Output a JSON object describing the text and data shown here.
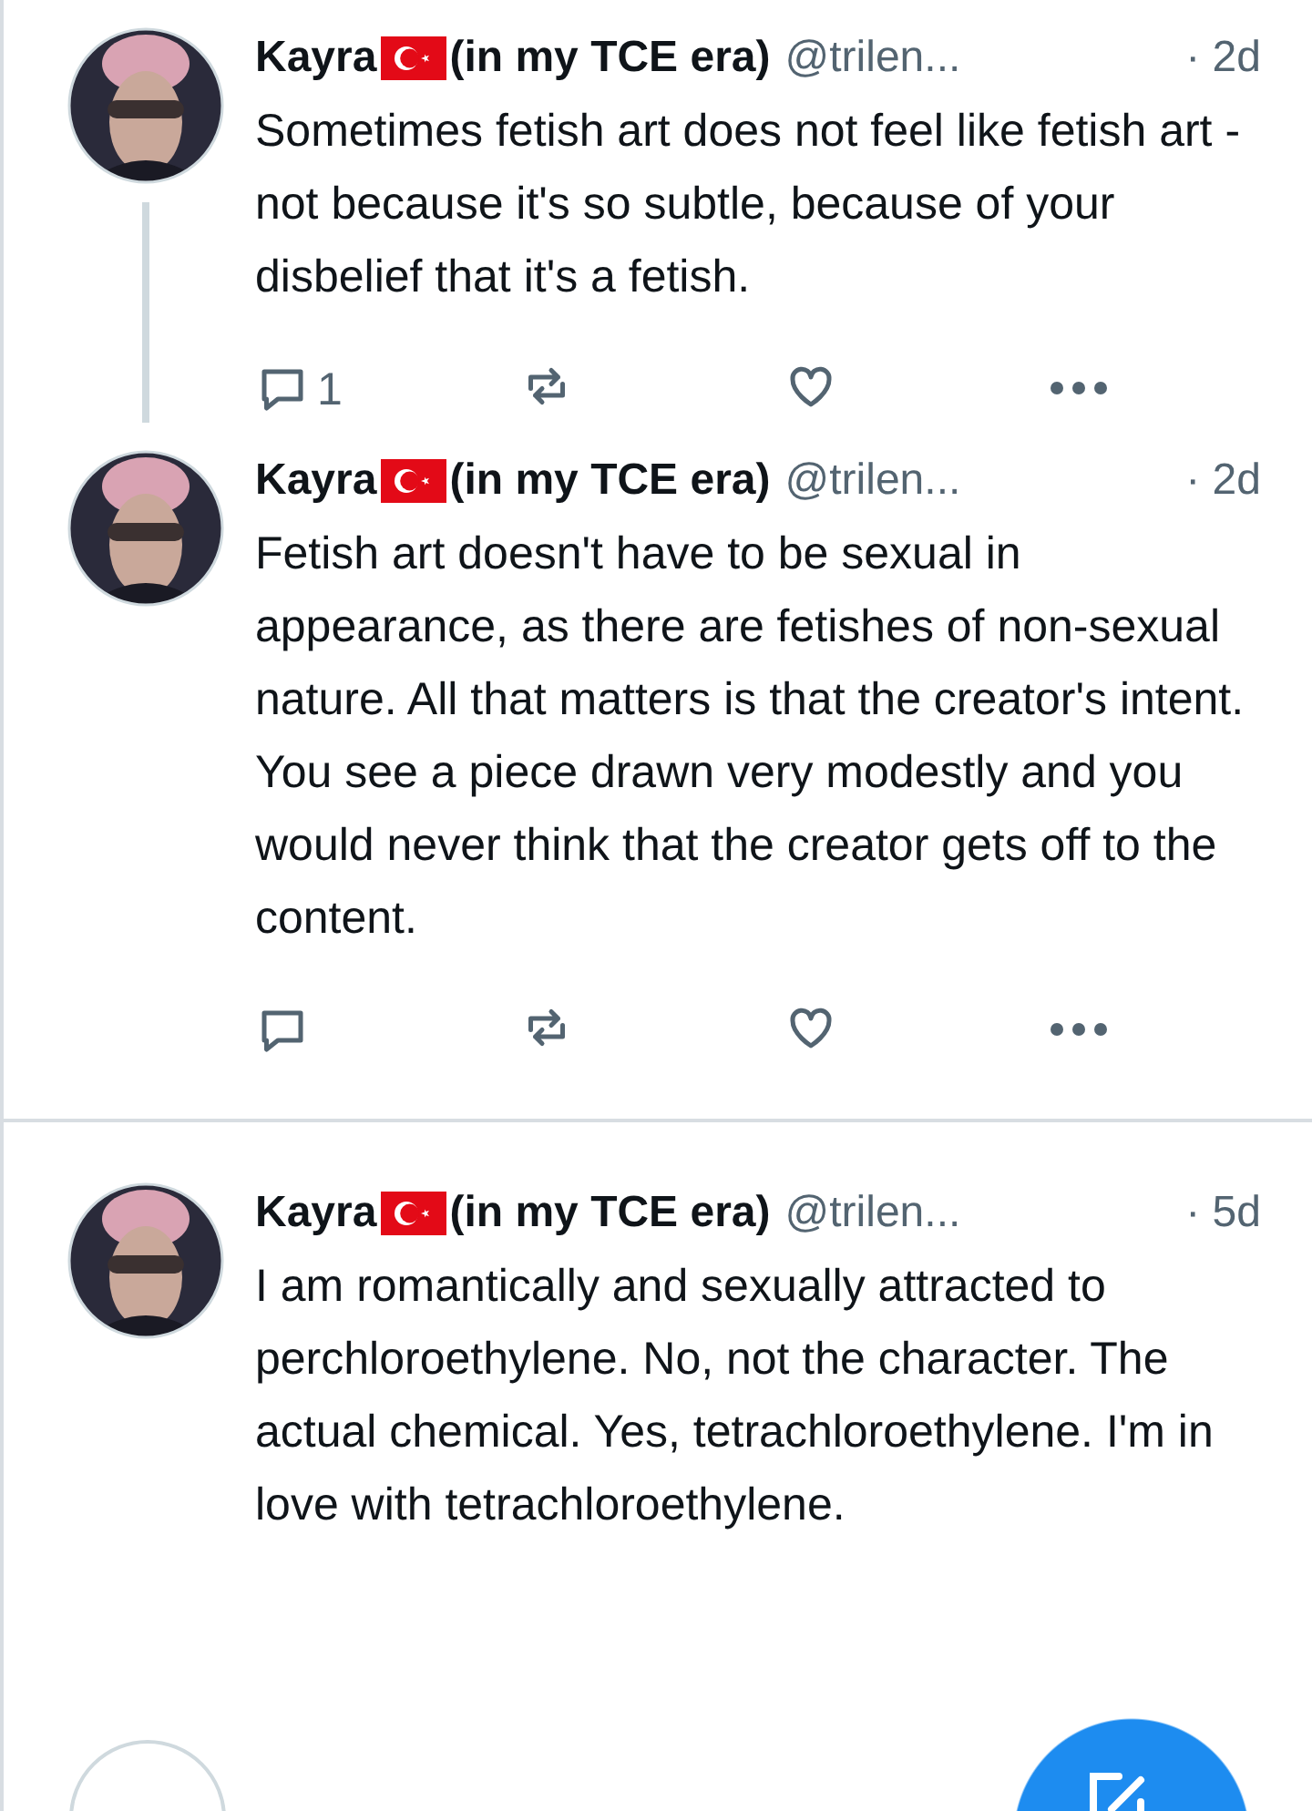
{
  "tweets": [
    {
      "name": "Kayra",
      "name_suffix": "(in my TCE era)",
      "handle": "@trilen...",
      "time": "· 2d",
      "text": "Sometimes fetish art does not feel like fetish art - not because it's so subtle, because of your disbelief that it's a fetish.",
      "reply_count": "1",
      "thread_line": true,
      "divider": false,
      "actions": true
    },
    {
      "name": "Kayra",
      "name_suffix": "(in my TCE era)",
      "handle": "@trilen...",
      "time": "· 2d",
      "text": "Fetish art doesn't have to be sexual in appearance, as there are fetishes of non-sexual nature. All that matters is that the creator's intent. You see a piece drawn very modestly and you would never think that the creator gets off to the content.",
      "thread_line": false,
      "divider": true,
      "actions": true
    },
    {
      "name": "Kayra",
      "name_suffix": "(in my TCE era)",
      "handle": "@trilen...",
      "time": "· 5d",
      "text": "I am romantically and sexually attracted to perchloroethylene. No, not the character. The actual chemical. Yes, tetrachloroethylene. I'm in love with tetrachloroethylene.",
      "thread_line": false,
      "divider": false,
      "actions": false
    }
  ]
}
